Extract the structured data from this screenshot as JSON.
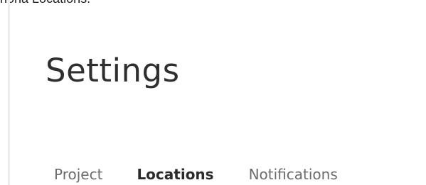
{
  "caption": "nona Locations.",
  "header": {
    "title": "Settings"
  },
  "tabs": [
    {
      "label": "Project",
      "active": false
    },
    {
      "label": "Locations",
      "active": true
    },
    {
      "label": "Notifications",
      "active": false
    }
  ]
}
